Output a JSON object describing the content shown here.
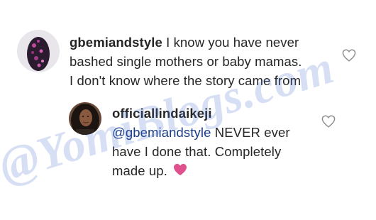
{
  "comments": [
    {
      "username": "gbemiandstyle",
      "lines": [
        "I know you have never",
        "bashed single mothers or baby mamas.",
        "I don't know where the story came from"
      ]
    },
    {
      "username": "officiallindaikeji",
      "mention": "@gbemiandstyle",
      "lines": [
        "NEVER ever",
        "have I done that. Completely",
        "made up."
      ],
      "emoji": "heart"
    }
  ],
  "watermark": "@YomiBlogs.com",
  "colors": {
    "text": "#262626",
    "mention": "#1a3c85",
    "heart": "#e0508c",
    "like_icon": "#8e8e8e"
  },
  "icons": {
    "like": "heart-outline-icon",
    "emoji": "pink-heart-emoji"
  }
}
